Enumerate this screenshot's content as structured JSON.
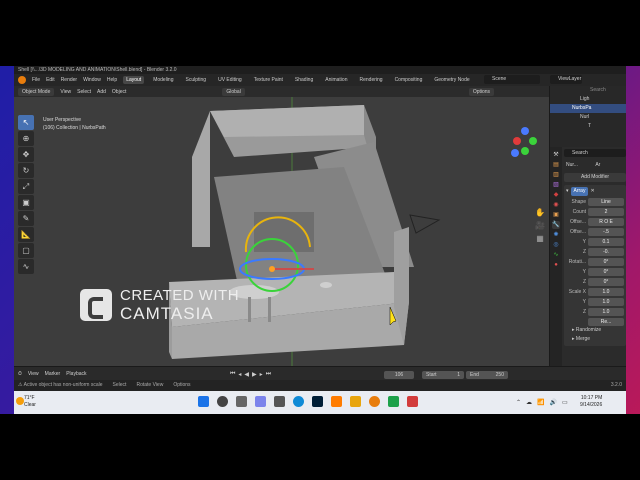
{
  "titlebar": "Shell [\\\\...\\3D MODELING AND ANIMATION\\Shell.blend] - Blender 3.2.0",
  "menu": [
    "File",
    "Edit",
    "Render",
    "Window",
    "Help"
  ],
  "workspaces": [
    "Layout",
    "Modeling",
    "Sculpting",
    "UV Editing",
    "Texture Paint",
    "Shading",
    "Animation",
    "Rendering",
    "Compositing",
    "Geometry Node"
  ],
  "scene": "Scene",
  "view_layer": "ViewLayer",
  "viewport_header": {
    "mode": "Object Mode",
    "view": "View",
    "select": "Select",
    "add": "Add",
    "object": "Object",
    "orientation": "Global",
    "options": "Options"
  },
  "viewport_info": {
    "line1": "User Perspective",
    "line2": "(106) Collection | NurbsPath"
  },
  "watermark": {
    "line1": "CREATED WITH",
    "line2": "CAMTASIA"
  },
  "outliner": {
    "search": "Search",
    "rows": [
      "Ligh",
      "NurbsPa",
      "Nurl",
      "T"
    ]
  },
  "properties": {
    "search": "Search",
    "object_name": "Nur...",
    "object_short": "Ar",
    "add_modifier": "Add Modifier",
    "modifier_name": "Array",
    "fields": [
      {
        "label": "Shape",
        "value": "Line"
      },
      {
        "label": "Count",
        "value": "2"
      },
      {
        "label": "Offse...",
        "value": "R O E"
      },
      {
        "label": "Offse...",
        "value": "-.5"
      },
      {
        "label": "Y",
        "value": "0.1"
      },
      {
        "label": "Z",
        "value": "-0."
      },
      {
        "label": "Rotati...",
        "value": "0°"
      },
      {
        "label": "Y",
        "value": "0°"
      },
      {
        "label": "Z",
        "value": "0°"
      },
      {
        "label": "Scale X",
        "value": "1.0"
      },
      {
        "label": "Y",
        "value": "1.0"
      },
      {
        "label": "Z",
        "value": "1.0"
      },
      {
        "label": "",
        "value": "Re..."
      }
    ],
    "randomize": "Randomize",
    "merge": "Merge"
  },
  "timeline": {
    "view": "View",
    "marker": "Marker",
    "playback": "Playback",
    "frame": "106",
    "start_label": "Start",
    "start": "1",
    "end_label": "End",
    "end": "250"
  },
  "status": {
    "warning": "Active object has non-uniform scale",
    "select": "Select",
    "rotate": "Rotate View",
    "options": "Options",
    "version": "3.2.0"
  },
  "taskbar": {
    "temp": "71°F",
    "condition": "Clear",
    "time": "10:17 PM",
    "date": "9/14/2026"
  },
  "colors": {
    "blender_orange": "#e87d0d",
    "accent_blue": "#4772b3"
  }
}
